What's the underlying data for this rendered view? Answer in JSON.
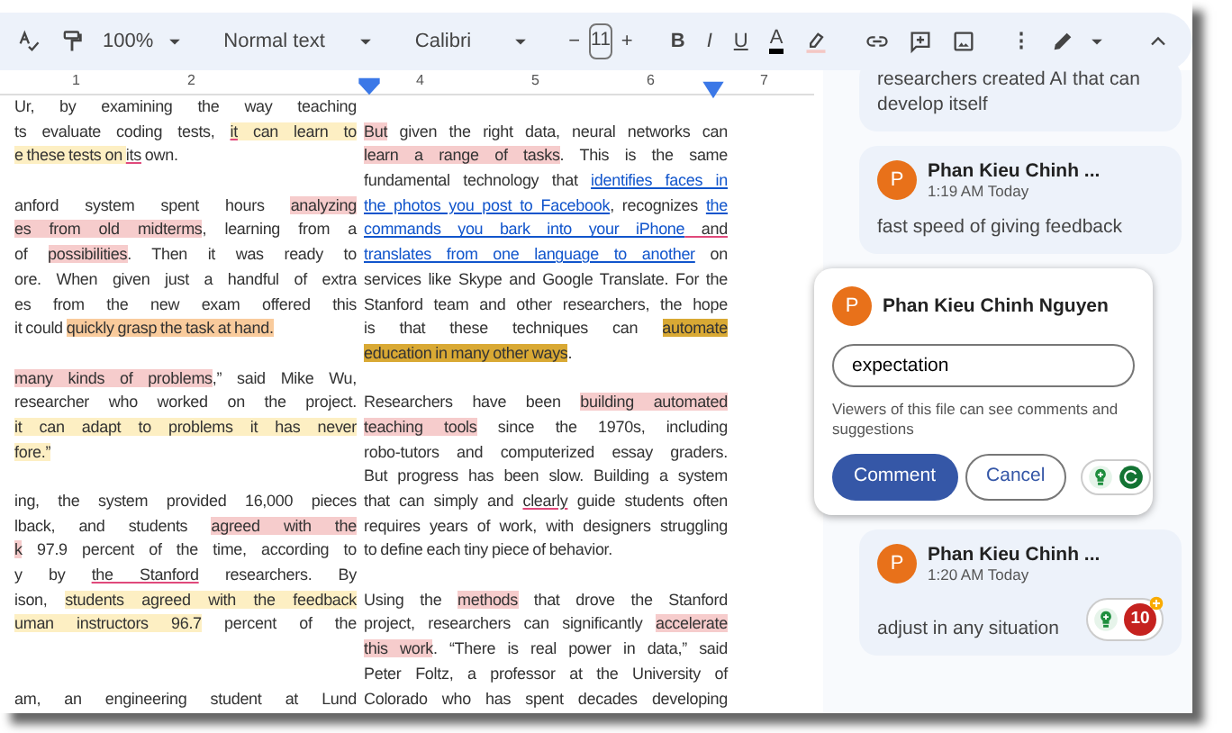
{
  "toolbar": {
    "zoom": "100%",
    "style": "Normal text",
    "font": "Calibri",
    "size_minus": "−",
    "font_size": "11",
    "size_plus": "+",
    "format_buttons": [
      {
        "label": "B",
        "kind": "bold"
      },
      {
        "label": "I",
        "kind": "italic"
      },
      {
        "label": "U",
        "kind": "underline"
      },
      {
        "label": "A",
        "kind": "text-color"
      }
    ],
    "more": "⋮"
  },
  "ruler": {
    "numbers": [
      "1",
      "2",
      "4",
      "5",
      "6",
      "7"
    ]
  },
  "document": {
    "columns": [
      {
        "paragraphs": [
          {
            "extra_space": false,
            "last_line_justified": false,
            "lines": [
              {
                "segments": [
                  {
                    "text": "Ur, by examining the way teaching"
                  }
                ]
              },
              {
                "segments": [
                  {
                    "text": "ts evaluate coding tests, "
                  },
                  {
                    "text": "it",
                    "color": "#fdefc3",
                    "misspelled": true
                  },
                  {
                    "text": " can learn to",
                    "color": "#fdefc3"
                  }
                ]
              },
              {
                "segments": [
                  {
                    "text": "e these tests on ",
                    "color": "#fdefc3"
                  },
                  {
                    "text": "its",
                    "misspelled": true
                  },
                  {
                    "text": " own."
                  }
                ]
              }
            ]
          },
          {
            "extra_space": false,
            "last_line_justified": false,
            "lines": [
              {
                "segments": [
                  {
                    "text": "anford system spent hours "
                  },
                  {
                    "text": "analyzing",
                    "color": "#f6cccc"
                  }
                ]
              },
              {
                "segments": [
                  {
                    "text": "es from old midterms",
                    "color": "#f6cccc"
                  },
                  {
                    "text": ", learning from a"
                  }
                ]
              },
              {
                "segments": [
                  {
                    "text": "of "
                  },
                  {
                    "text": "possibilities",
                    "color": "#f6cccc"
                  },
                  {
                    "text": ". Then it was ready to"
                  }
                ]
              },
              {
                "segments": [
                  {
                    "text": "ore. When given just a handful of extra"
                  }
                ]
              },
              {
                "segments": [
                  {
                    "text": "es from the new exam offered this"
                  }
                ]
              },
              {
                "segments": [
                  {
                    "text": "it could "
                  },
                  {
                    "text": "quickly grasp the task at hand.",
                    "color": "#f9cb9c"
                  }
                ]
              }
            ]
          },
          {
            "extra_space": false,
            "lines": [
              {
                "segments": [
                  {
                    "text": "many kinds of problems",
                    "color": "#f6cccc"
                  },
                  {
                    "text": ",” said Mike Wu,"
                  }
                ]
              },
              {
                "segments": [
                  {
                    "text": "researcher who worked on the project."
                  }
                ]
              },
              {
                "segments": [
                  {
                    "text": "it can adapt to problems it has never",
                    "color": "#fdefc3"
                  }
                ]
              },
              {
                "segments": [
                  {
                    "text": "fore.”",
                    "color": "#fdefc3"
                  }
                ]
              }
            ]
          },
          {
            "extra_space": false,
            "last_line_justified": true,
            "lines": [
              {
                "segments": [
                  {
                    "text": "ing, the system provided 16,000 pieces"
                  }
                ]
              },
              {
                "segments": [
                  {
                    "text": "lback, and students "
                  },
                  {
                    "text": "agreed with the",
                    "color": "#f6cccc"
                  }
                ]
              },
              {
                "segments": [
                  {
                    "text": "k",
                    "color": "#f6cccc"
                  },
                  {
                    "text": " 97.9 percent of the time, according to"
                  }
                ]
              },
              {
                "segments": [
                  {
                    "text": "y by "
                  },
                  {
                    "text": "the Stanford",
                    "misspelled": true
                  },
                  {
                    "text": " researchers. By"
                  }
                ]
              },
              {
                "segments": [
                  {
                    "text": "ison, "
                  },
                  {
                    "text": "students agreed with the feedback",
                    "color": "#fdefc3"
                  }
                ]
              },
              {
                "segments": [
                  {
                    "text": "uman instructors 96.7",
                    "color": "#fdefc3"
                  },
                  {
                    "text": " percent of the"
                  }
                ]
              }
            ]
          },
          {
            "extra_space": true,
            "last_line_justified": true,
            "lines": [
              {
                "segments": [
                  {
                    "text": "am, an engineering student at Lund"
                  }
                ]
              }
            ]
          }
        ]
      },
      {
        "paragraphs": [
          {
            "extra_space": false,
            "last_line_justified": false,
            "lines": [
              {
                "segments": [
                  {
                    "text": "But",
                    "color": "#f6cccc"
                  },
                  {
                    "text": " given the right data, neural networks can"
                  }
                ]
              },
              {
                "segments": [
                  {
                    "text": "learn a range of tasks",
                    "color": "#f6cccc"
                  },
                  {
                    "text": ". This is the same"
                  }
                ]
              },
              {
                "segments": [
                  {
                    "text": "fundamental technology that "
                  },
                  {
                    "text": "identifies faces in",
                    "link": true
                  }
                ]
              },
              {
                "segments": [
                  {
                    "text": "the photos you post to Facebook",
                    "link": true
                  },
                  {
                    "text": ", recognizes "
                  },
                  {
                    "text": "the",
                    "link": true
                  }
                ]
              },
              {
                "segments": [
                  {
                    "text": "commands you bark into your iPhone",
                    "link": true
                  },
                  {
                    "text": " and",
                    "misspelled": true
                  }
                ]
              },
              {
                "segments": [
                  {
                    "text": "translates from one language to another",
                    "link": true
                  },
                  {
                    "text": " on"
                  }
                ]
              },
              {
                "segments": [
                  {
                    "text": "services like Skype and Google Translate. For the"
                  }
                ]
              },
              {
                "segments": [
                  {
                    "text": "Stanford team and other researchers, the hope"
                  }
                ]
              },
              {
                "segments": [
                  {
                    "text": "is that these techniques can "
                  },
                  {
                    "text": "automate",
                    "color": "#d9a934"
                  }
                ]
              },
              {
                "segments": [
                  {
                    "text": "education in many other ways",
                    "color": "#d9a934"
                  },
                  {
                    "text": "."
                  }
                ]
              }
            ]
          },
          {
            "extra_space": false,
            "last_line_justified": false,
            "lines": [
              {
                "segments": [
                  {
                    "text": "Researchers have been "
                  },
                  {
                    "text": "building automated",
                    "color": "#f6cccc"
                  }
                ]
              },
              {
                "segments": [
                  {
                    "text": "teaching tools",
                    "color": "#f6cccc"
                  },
                  {
                    "text": " since the 1970s, including"
                  }
                ]
              },
              {
                "segments": [
                  {
                    "text": "robo-tutors and computerized essay graders."
                  }
                ]
              },
              {
                "segments": [
                  {
                    "text": "But progress has been slow. Building a system"
                  }
                ]
              },
              {
                "segments": [
                  {
                    "text": "that can simply and "
                  },
                  {
                    "text": "clearly",
                    "misspelled": true
                  },
                  {
                    "text": " guide students often"
                  }
                ]
              },
              {
                "segments": [
                  {
                    "text": "requires years of work, with designers struggling"
                  }
                ]
              },
              {
                "segments": [
                  {
                    "text": "to define each tiny piece of behavior."
                  }
                ]
              }
            ]
          },
          {
            "extra_space": false,
            "last_line_justified": true,
            "lines": [
              {
                "segments": [
                  {
                    "text": "Using the "
                  },
                  {
                    "text": "methods",
                    "color": "#f6cccc"
                  },
                  {
                    "text": " that drove the Stanford"
                  }
                ]
              },
              {
                "segments": [
                  {
                    "text": "project, researchers can significantly "
                  },
                  {
                    "text": "accelerate",
                    "color": "#f6cccc"
                  }
                ]
              },
              {
                "segments": [
                  {
                    "text": "this work",
                    "color": "#f6cccc"
                  },
                  {
                    "text": ". “There is real power in data,” said"
                  }
                ]
              },
              {
                "segments": [
                  {
                    "text": "Peter Foltz, a professor at the University of"
                  }
                ]
              },
              {
                "segments": [
                  {
                    "text": "Colorado who has spent decades developing"
                  }
                ]
              }
            ]
          }
        ]
      }
    ]
  },
  "comments": [
    {
      "kind": "comment",
      "body": "researchers created AI that can develop itself"
    },
    {
      "kind": "comment",
      "avatar": "P",
      "author": "Phan Kieu Chinh ...",
      "time": "1:19 AM Today",
      "body": "fast speed of giving feedback"
    },
    {
      "kind": "reply-box",
      "avatar": "P",
      "author": "Phan Kieu Chinh Nguyen",
      "value": "expectation",
      "note": "Viewers of this file can see comments and suggestions",
      "buttons": [
        {
          "label": "Comment",
          "kind": "primary"
        },
        {
          "label": "Cancel",
          "kind": "secondary"
        }
      ]
    },
    {
      "kind": "comment",
      "avatar": "P",
      "author": "Phan Kieu Chinh ...",
      "time": "1:20 AM Today",
      "body": "adjust in any situation",
      "badge": "10"
    }
  ]
}
